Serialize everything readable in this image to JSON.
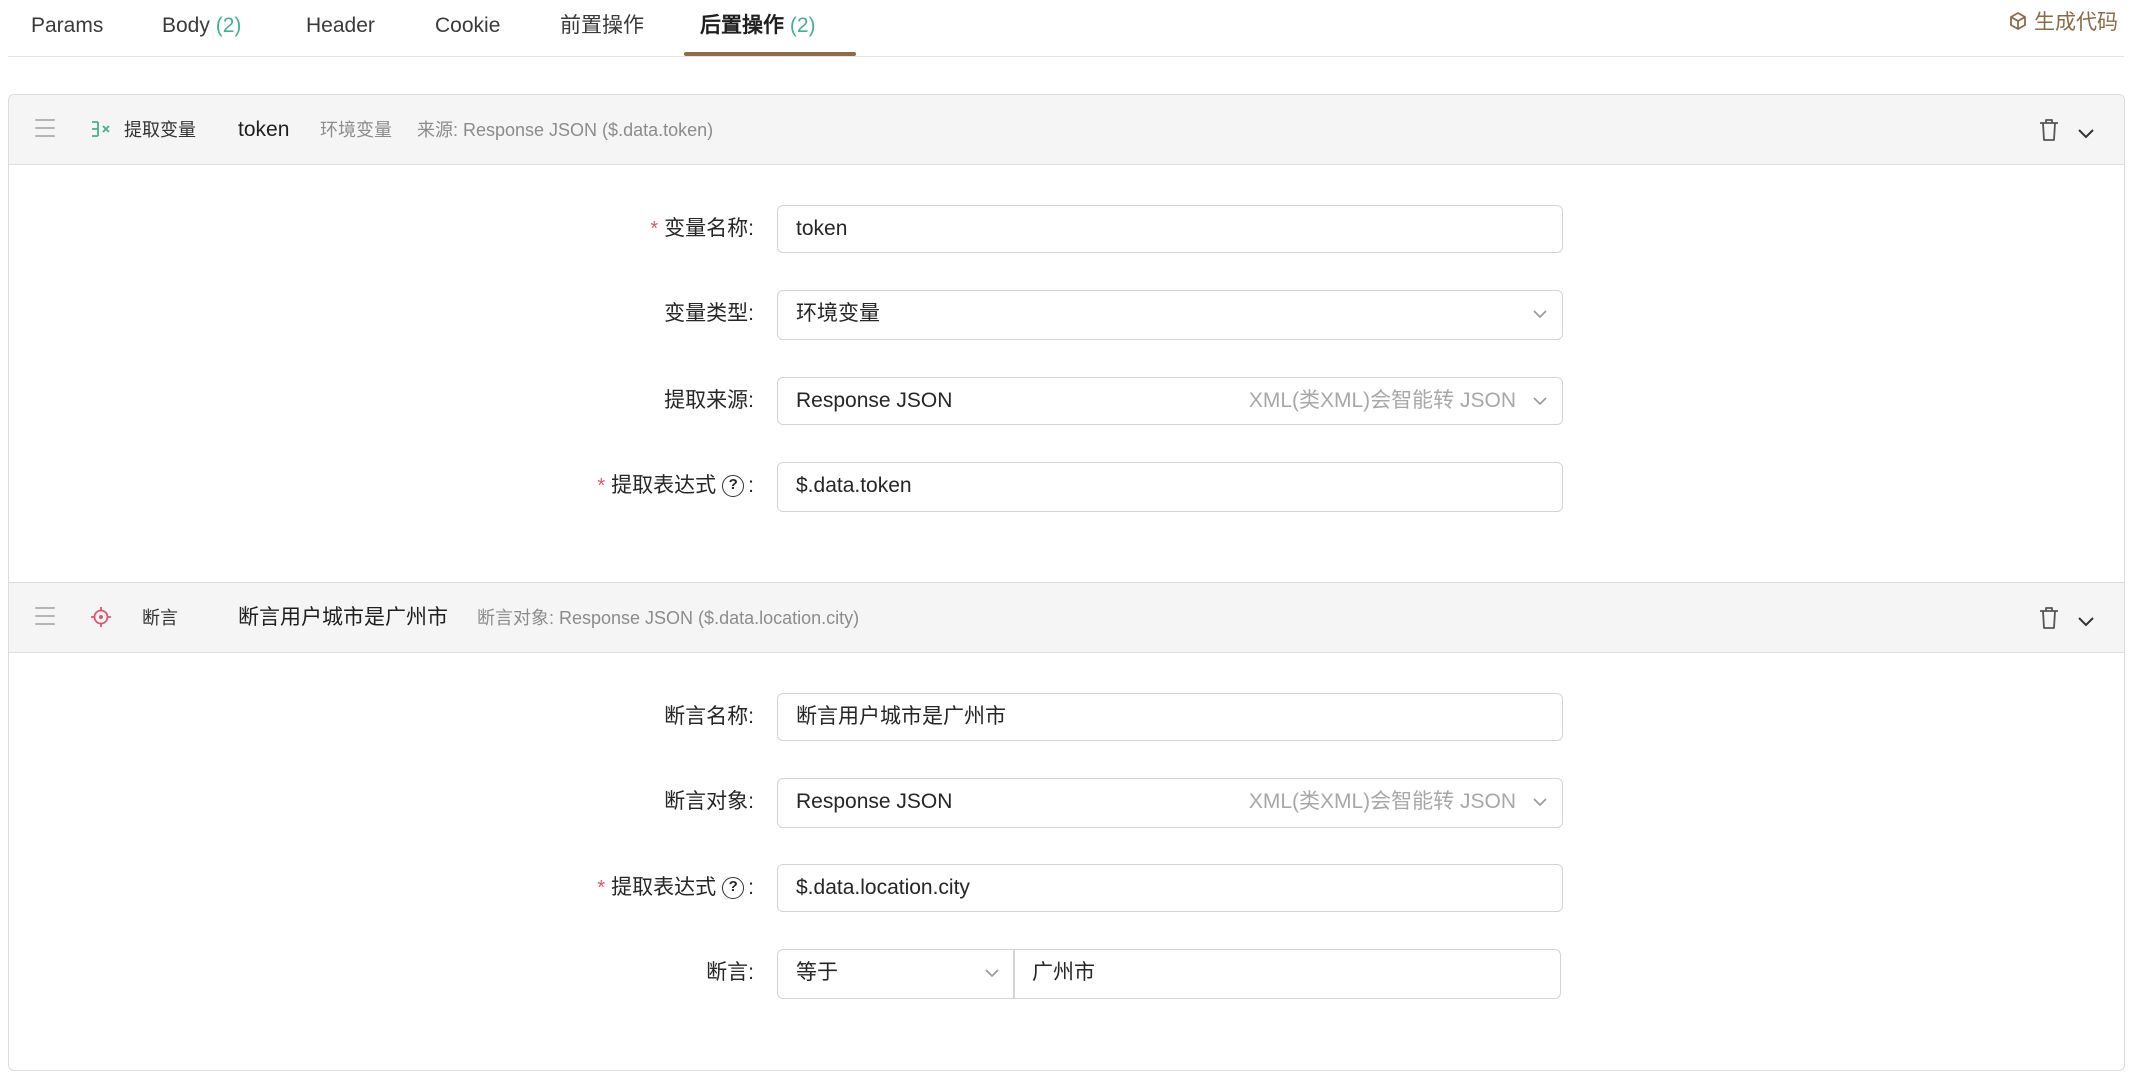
{
  "tabs": [
    {
      "label": "Params",
      "count": ""
    },
    {
      "label": "Body",
      "count": "(2)"
    },
    {
      "label": "Header",
      "count": ""
    },
    {
      "label": "Cookie",
      "count": ""
    },
    {
      "label": "前置操作",
      "count": ""
    },
    {
      "label": "后置操作",
      "count": "(2)"
    }
  ],
  "active_tab": "后置操作",
  "generate_code_label": "生成代码",
  "colors": {
    "accent": "#8b6b48",
    "count": "#46b28c",
    "required": "#e0556f",
    "extract_icon": "#46b28c",
    "assert_icon": "#e0556f"
  },
  "extract": {
    "icon": "extract-variable-icon",
    "type_label": "提取变量",
    "name": "token",
    "scope": "环境变量",
    "source_summary": "来源: Response JSON ($.data.token)",
    "fields": {
      "var_name_label": "变量名称",
      "var_name_value": "token",
      "var_type_label": "变量类型",
      "var_type_value": "环境变量",
      "source_label": "提取来源",
      "source_value": "Response JSON",
      "source_hint": "XML(类XML)会智能转 JSON",
      "expr_label": "提取表达式",
      "expr_value": "$.data.token"
    }
  },
  "assertion": {
    "icon": "crosshair-icon",
    "type_label": "断言",
    "name": "断言用户城市是广州市",
    "target_summary": "断言对象: Response JSON ($.data.location.city)",
    "fields": {
      "name_label": "断言名称",
      "name_value": "断言用户城市是广州市",
      "target_label": "断言对象",
      "target_value": "Response JSON",
      "target_hint": "XML(类XML)会智能转 JSON",
      "expr_label": "提取表达式",
      "expr_value": "$.data.location.city",
      "assert_label": "断言",
      "operator_value": "等于",
      "expected_value": "广州市"
    }
  }
}
